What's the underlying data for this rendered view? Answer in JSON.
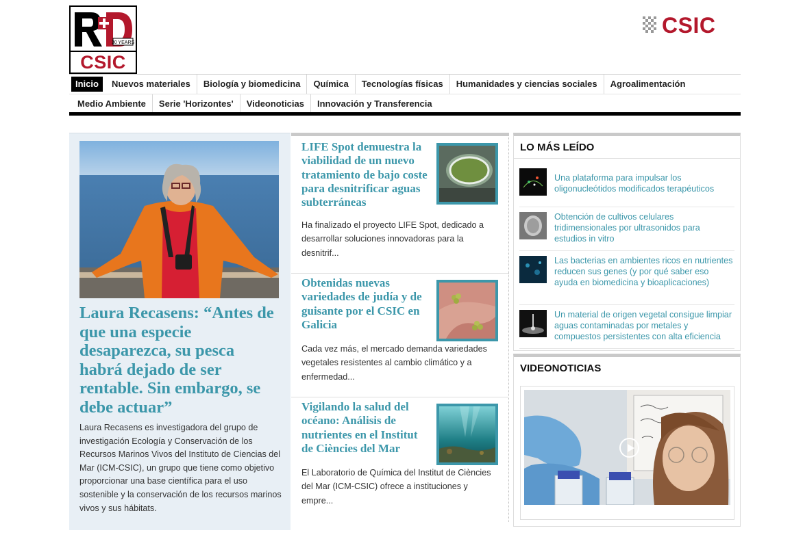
{
  "header": {
    "logo_top_text": "R+D",
    "logo_badge": "30 YEARS",
    "logo_csic": "CSIC",
    "brand": "CSIC"
  },
  "nav": {
    "row1": [
      {
        "label": "Inicio",
        "active": true
      },
      {
        "label": "Nuevos materiales"
      },
      {
        "label": "Biología y biomedicina"
      },
      {
        "label": "Química"
      },
      {
        "label": "Tecnologías físicas"
      },
      {
        "label": "Humanidades y ciencias sociales"
      },
      {
        "label": "Agroalimentación"
      }
    ],
    "row2": [
      {
        "label": "Medio Ambiente"
      },
      {
        "label": "Serie 'Horizontes'"
      },
      {
        "label": "Videonoticias"
      },
      {
        "label": "Innovación y Transferencia"
      }
    ]
  },
  "featured": {
    "title": "Laura Recasens: “Antes de que una especie desaparezca, su pesca habrá dejado de ser rentable. Sin embargo, se debe actuar”",
    "description": "Laura Recasens es investigadora del grupo de investigación Ecología y Conservación de los Recursos Marinos Vivos del Instituto de Ciencias del Mar (ICM-CSIC), un grupo que tiene como objetivo proporcionar una base científica para el uso sostenible y la conservación de los recursos marinos vivos y sus hábitats."
  },
  "articles": [
    {
      "title": "LIFE Spot demuestra la viabilidad de un nuevo tratamiento de bajo coste para desnitrificar aguas subterráneas",
      "description": "Ha finalizado el proyecto LIFE Spot, dedicado a desarrollar soluciones innovadoras para la desnitrif..."
    },
    {
      "title": "Obtenidas nuevas variedades de judía y de guisante por el CSIC en Galicia",
      "description": "Cada vez más, el mercado demanda variedades vegetales resistentes al cambio climático y a enfermedad..."
    },
    {
      "title": "Vigilando la salud del océano: Análisis de nutrientes en el Institut de Ciències del Mar",
      "description": "El Laboratorio de Química del Institut de Ciències del Mar (ICM-CSIC) ofrece a instituciones y empre..."
    }
  ],
  "most_read": {
    "title": "LO MÁS LEÍDO",
    "items": [
      "Una plataforma para impulsar los oligonucleótidos modificados terapéuticos",
      "Obtención de cultivos celulares tridimensionales por ultrasonidos para estudios in vitro",
      "Las bacterias en ambientes ricos en nutrientes reducen sus genes (y por qué saber eso ayuda en biomedicina y bioaplicaciones)",
      "Un material de origen vegetal consigue limpiar aguas contaminadas por metales y compuestos persistentes con alta eficiencia"
    ]
  },
  "videos": {
    "title": "VIDEONOTICIAS"
  },
  "colors": {
    "accent": "#3c97aa",
    "brand_red": "#b3182c",
    "featured_bg": "#e8eff5"
  }
}
